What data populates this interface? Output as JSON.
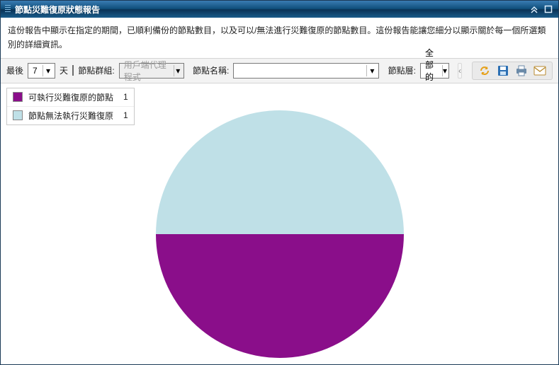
{
  "window": {
    "title": "節點災難復原狀態報告"
  },
  "description": "這份報告中顯示在指定的期間，已順利備份的節點數目，以及可以/無法進行災難復原的節點數目。這份報告能讓您細分以顯示關於每一個所選類別的詳細資訊。",
  "toolbar": {
    "last_label": "最後",
    "last_value": "7",
    "days_label": "天",
    "group_label": "節點群組:",
    "group_value": "用戶端代理程式",
    "name_label": "節點名稱:",
    "name_value": "",
    "tier_label": "節點層:",
    "tier_value": "全部的層"
  },
  "actions": {
    "refresh": "refresh",
    "save": "save",
    "print": "print",
    "email": "email"
  },
  "colors": {
    "can": "#8a0e8a",
    "cannot": "#bfe0e7"
  },
  "legend": [
    {
      "key": "can",
      "label": "可執行災難復原的節點",
      "value": 1
    },
    {
      "key": "cannot",
      "label": "節點無法執行災難復原",
      "value": 1
    }
  ],
  "chart_data": {
    "type": "pie",
    "title": "",
    "series": [
      {
        "name": "可執行災難復原的節點",
        "value": 1,
        "color": "#8a0e8a"
      },
      {
        "name": "節點無法執行災難復原",
        "value": 1,
        "color": "#bfe0e7"
      }
    ]
  }
}
